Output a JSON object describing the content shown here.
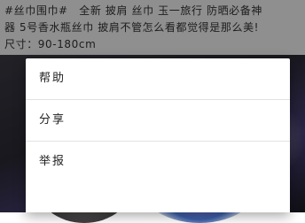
{
  "post": {
    "line1": "#丝巾围巾#　全新 披肩 丝巾 玉一旅行 防晒必备神",
    "line2": "器 5号香水瓶丝巾 披肩不管怎么看都觉得是那么美!",
    "line3": "尺寸：90-180cm"
  },
  "menu": {
    "items": [
      {
        "label": "帮助"
      },
      {
        "label": "分享"
      },
      {
        "label": "举报"
      }
    ]
  }
}
